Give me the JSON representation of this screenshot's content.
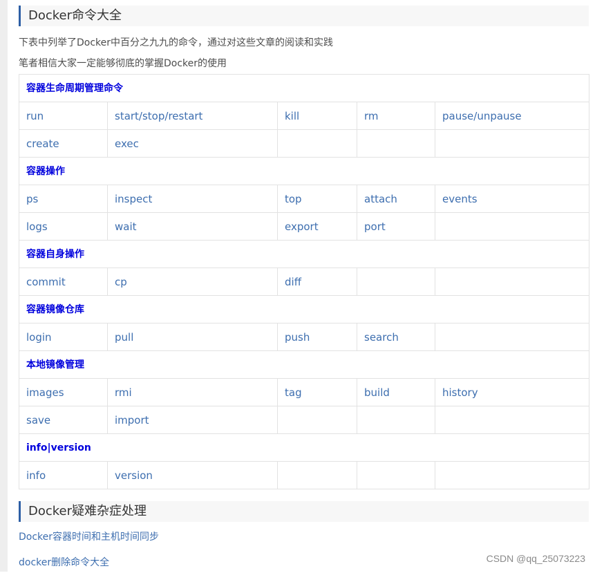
{
  "section1": {
    "title": "Docker命令大全",
    "intro_line1": "下表中列举了Docker中百分之九九的命令，通过对这些文章的阅读和实践",
    "intro_line2": "笔者相信大家一定能够彻底的掌握Docker的使用"
  },
  "command_table": [
    {
      "category": "容器生命周期管理命令",
      "rows": [
        [
          "run",
          "start/stop/restart",
          "kill",
          "rm",
          "pause/unpause"
        ],
        [
          "create",
          "exec",
          "",
          "",
          ""
        ]
      ]
    },
    {
      "category": "容器操作",
      "rows": [
        [
          "ps",
          "inspect",
          "top",
          "attach",
          "events"
        ],
        [
          "logs",
          "wait",
          "export",
          "port",
          ""
        ]
      ]
    },
    {
      "category": "容器自身操作",
      "rows": [
        [
          "commit",
          "cp",
          "diff",
          "",
          ""
        ]
      ]
    },
    {
      "category": "容器镜像仓库",
      "rows": [
        [
          "login",
          "pull",
          "push",
          "search",
          ""
        ]
      ]
    },
    {
      "category": "本地镜像管理",
      "rows": [
        [
          "images",
          "rmi",
          "tag",
          "build",
          "history"
        ],
        [
          "save",
          "import",
          "",
          "",
          ""
        ]
      ]
    },
    {
      "category": "info|version",
      "rows": [
        [
          "info",
          "version",
          "",
          "",
          ""
        ]
      ]
    }
  ],
  "section2": {
    "title": "Docker疑难杂症处理",
    "links": [
      "Docker容器时间和主机时间同步",
      "docker删除命令大全"
    ]
  },
  "watermark": "CSDN @qq_25073223",
  "colors": {
    "accent_bar": "#2e5fa5",
    "category_text": "#0000dd",
    "link_text": "#3d6eaf",
    "heading_bg": "#f7f7f7",
    "table_border": "#e2e2e2"
  }
}
